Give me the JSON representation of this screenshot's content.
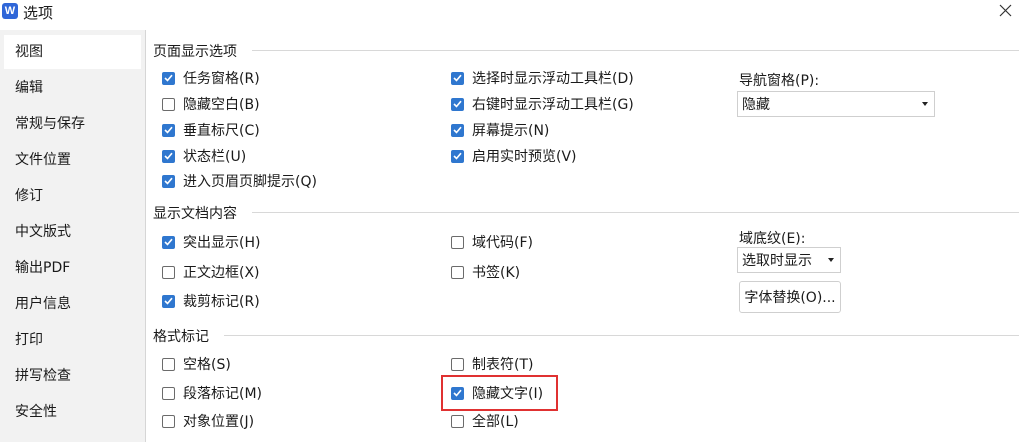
{
  "window": {
    "title": "选项",
    "app_icon_letter": "W"
  },
  "sidebar": {
    "items": [
      {
        "label": "视图",
        "active": true
      },
      {
        "label": "编辑"
      },
      {
        "label": "常规与保存"
      },
      {
        "label": "文件位置"
      },
      {
        "label": "修订"
      },
      {
        "label": "中文版式"
      },
      {
        "label": "输出PDF"
      },
      {
        "label": "用户信息"
      },
      {
        "label": "打印"
      },
      {
        "label": "拼写检查"
      },
      {
        "label": "安全性"
      }
    ]
  },
  "sections": {
    "page_display": "页面显示选项",
    "doc_content": "显示文档内容",
    "format_marks": "格式标记"
  },
  "page_display": {
    "task_pane": {
      "label": "任务窗格(R)",
      "checked": true
    },
    "hide_whitespace": {
      "label": "隐藏空白(B)",
      "checked": false
    },
    "vertical_ruler": {
      "label": "垂直标尺(C)",
      "checked": true
    },
    "status_bar": {
      "label": "状态栏(U)",
      "checked": true
    },
    "header_footer_hint": {
      "label": "进入页眉页脚提示(Q)",
      "checked": true
    },
    "floating_toolbar": {
      "label": "选择时显示浮动工具栏(D)",
      "checked": true
    },
    "right_click_toolbar": {
      "label": "右键时显示浮动工具栏(G)",
      "checked": true
    },
    "screen_tips": {
      "label": "屏幕提示(N)",
      "checked": true
    },
    "live_preview": {
      "label": "启用实时预览(V)",
      "checked": true
    },
    "nav_pane_label": "导航窗格(P):",
    "nav_pane_value": "隐藏"
  },
  "doc_content": {
    "highlight": {
      "label": "突出显示(H)",
      "checked": true
    },
    "text_boundaries": {
      "label": "正文边框(X)",
      "checked": false
    },
    "crop_marks": {
      "label": "裁剪标记(R)",
      "checked": true
    },
    "field_codes": {
      "label": "域代码(F)",
      "checked": false
    },
    "bookmarks": {
      "label": "书签(K)",
      "checked": false
    },
    "field_shading_label": "域底纹(E):",
    "field_shading_value": "选取时显示",
    "font_substitution_button": "字体替换(O)..."
  },
  "format_marks": {
    "spaces": {
      "label": "空格(S)",
      "checked": false
    },
    "paragraph_marks": {
      "label": "段落标记(M)",
      "checked": false
    },
    "object_anchors": {
      "label": "对象位置(J)",
      "checked": false
    },
    "tab_chars": {
      "label": "制表符(T)",
      "checked": false
    },
    "hidden_text": {
      "label": "隐藏文字(I)",
      "checked": true
    },
    "all": {
      "label": "全部(L)",
      "checked": false
    }
  },
  "colors": {
    "accent": "#2f77cf",
    "highlight_box": "#e03131",
    "sidebar_bg": "#f2f2f2"
  }
}
